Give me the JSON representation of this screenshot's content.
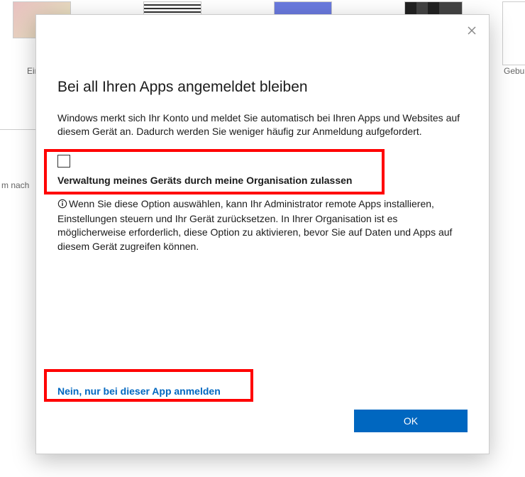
{
  "background": {
    "caption_left": "Einladu",
    "caption_right": "Geburts",
    "sidebar_text": "m nach"
  },
  "dialog": {
    "title": "Bei all Ihren Apps angemeldet bleiben",
    "body": "Windows merkt sich Ihr Konto und meldet Sie automatisch bei Ihren Apps und Websites auf diesem Gerät an. Dadurch werden Sie weniger häufig zur Anmeldung aufgefordert.",
    "checkbox_label": "Verwaltung meines Geräts durch meine Organisation zulassen",
    "checkbox_checked": false,
    "info_text": "Wenn Sie diese Option auswählen, kann Ihr Administrator remote Apps installieren, Einstellungen steuern und Ihr Gerät zurücksetzen. In Ihrer Organisation ist es möglicherweise erforderlich, diese Option zu aktivieren, bevor Sie auf Daten und Apps auf diesem Gerät zugreifen können.",
    "link_only_this_app": "Nein, nur bei dieser App anmelden",
    "ok_label": "OK"
  }
}
